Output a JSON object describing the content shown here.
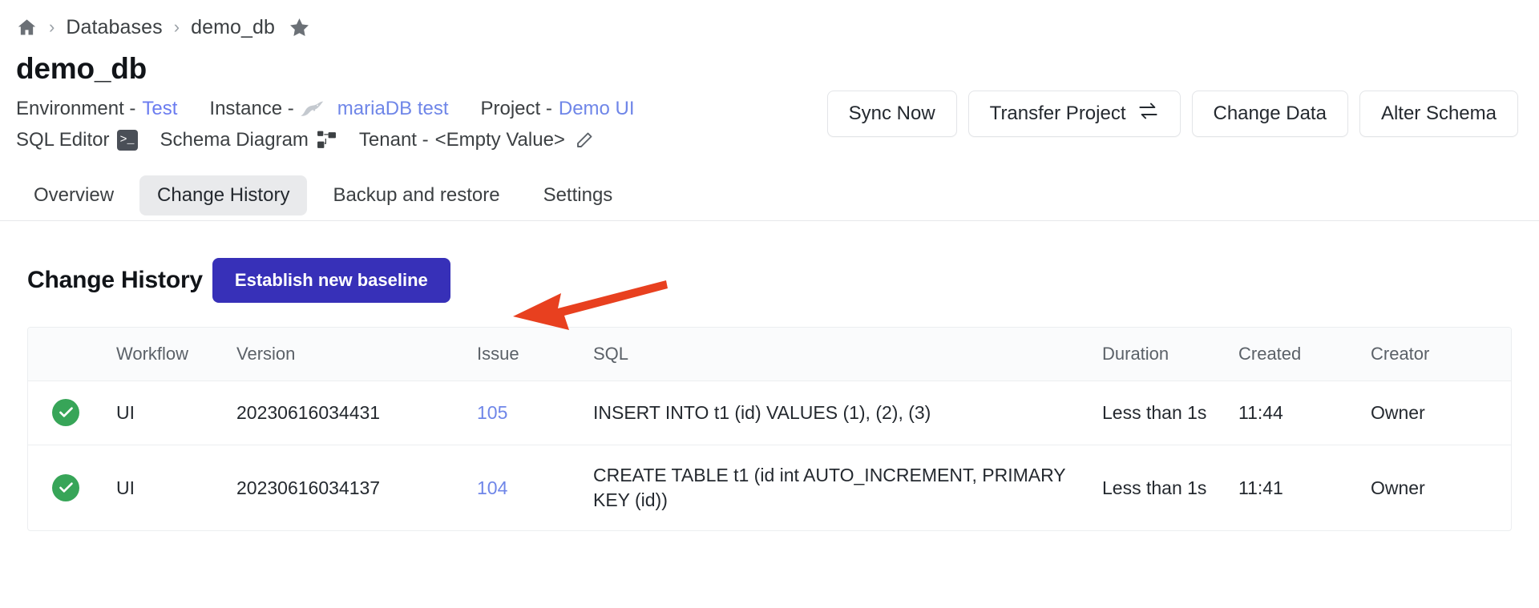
{
  "breadcrumb": {
    "home_icon": "home-icon",
    "separator": "›",
    "items": [
      "Databases",
      "demo_db"
    ],
    "star_icon": "star-icon"
  },
  "header": {
    "title": "demo_db",
    "meta_row_1": {
      "environment_label": "Environment -",
      "environment_value": "Test",
      "instance_label": "Instance -",
      "instance_value": "mariaDB test",
      "instance_icon": "mariadb-seal-icon",
      "project_label": "Project -",
      "project_value": "Demo UI"
    },
    "meta_row_2": {
      "sql_editor_label": "SQL Editor",
      "sql_editor_icon": "terminal-icon",
      "schema_diagram_label": "Schema Diagram",
      "schema_diagram_icon": "diagram-icon",
      "tenant_label": "Tenant -",
      "tenant_value": "<Empty Value>",
      "tenant_edit_icon": "pencil-icon"
    }
  },
  "actions": [
    {
      "label": "Sync Now",
      "icon": null
    },
    {
      "label": "Transfer Project",
      "icon": "transfer-arrows-icon"
    },
    {
      "label": "Change Data",
      "icon": null
    },
    {
      "label": "Alter Schema",
      "icon": null
    }
  ],
  "tabs": [
    {
      "label": "Overview",
      "active": false
    },
    {
      "label": "Change History",
      "active": true
    },
    {
      "label": "Backup and restore",
      "active": false
    },
    {
      "label": "Settings",
      "active": false
    }
  ],
  "section": {
    "title": "Change History",
    "primary_button": "Establish new baseline",
    "annotation": {
      "type": "arrow",
      "color": "#e8401f",
      "points_to": "Establish new baseline"
    }
  },
  "table": {
    "columns": [
      "",
      "Workflow",
      "Version",
      "Issue",
      "SQL",
      "Duration",
      "Created",
      "Creator"
    ],
    "rows": [
      {
        "status": "success",
        "status_icon": "check-circle-icon",
        "workflow": "UI",
        "version": "20230616034431",
        "issue": "105",
        "sql": "INSERT INTO t1 (id) VALUES (1), (2), (3)",
        "duration": "Less than 1s",
        "created": "11:44",
        "creator": "Owner"
      },
      {
        "status": "success",
        "status_icon": "check-circle-icon",
        "workflow": "UI",
        "version": "20230616034137",
        "issue": "104",
        "sql": "CREATE TABLE t1 (id int AUTO_INCREMENT, PRIMARY KEY (id))",
        "duration": "Less than 1s",
        "created": "11:41",
        "creator": "Owner"
      }
    ]
  },
  "colors": {
    "primary": "#3730b8",
    "link": "#6f86e8",
    "success": "#37a558",
    "annotation": "#e8401f",
    "tab_active_bg": "#e9eaec"
  }
}
